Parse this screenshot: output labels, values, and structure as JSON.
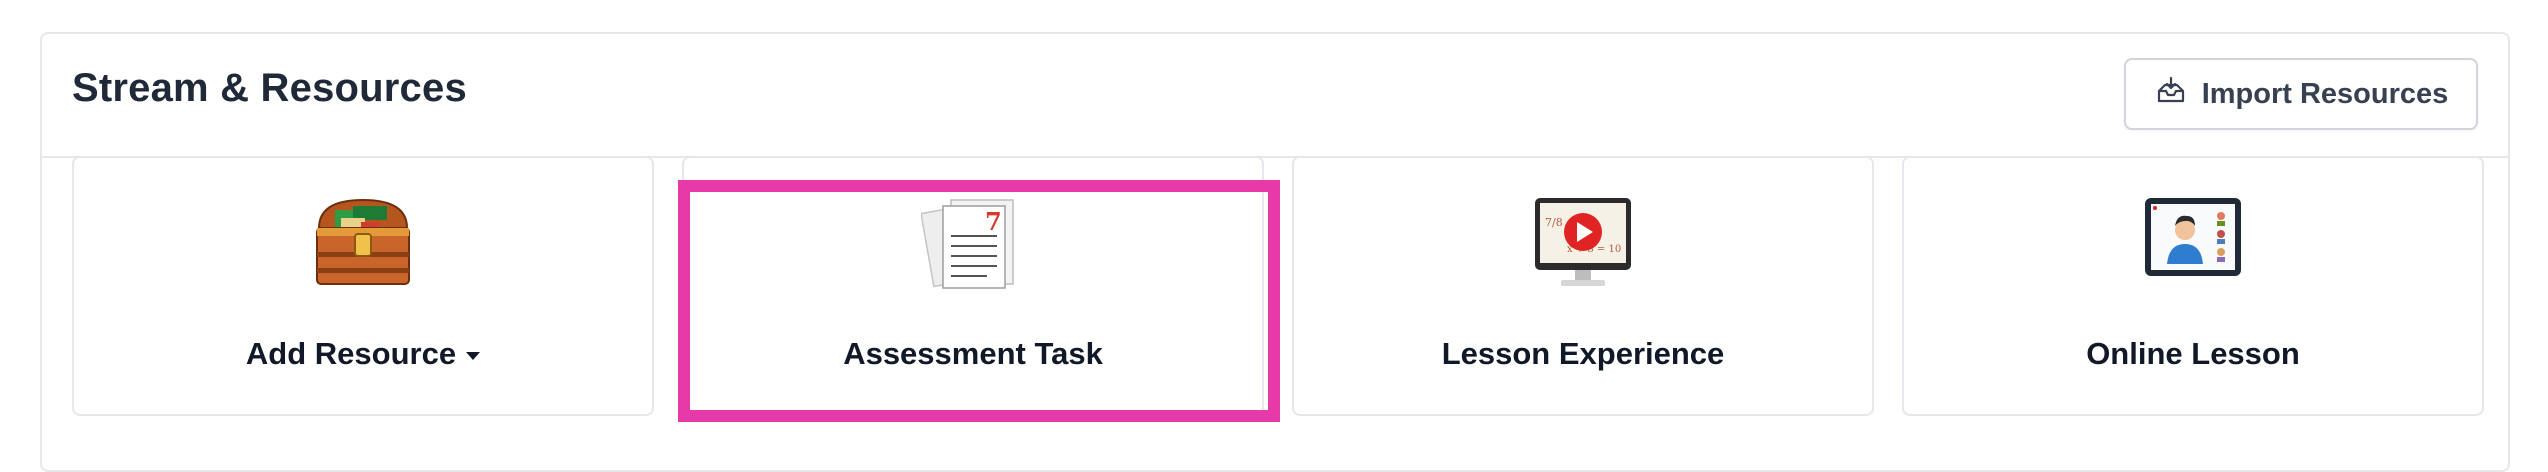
{
  "panel": {
    "title": "Stream & Resources",
    "import_button": {
      "label": "Import Resources",
      "icon": "import-tray-icon"
    }
  },
  "cards": [
    {
      "label": "Add Resource",
      "icon": "treasure-chest-icon",
      "has_dropdown": true
    },
    {
      "label": "Assessment Task",
      "icon": "documents-icon",
      "highlighted": true
    },
    {
      "label": "Lesson Experience",
      "icon": "monitor-play-icon"
    },
    {
      "label": "Online Lesson",
      "icon": "video-call-icon"
    }
  ],
  "colors": {
    "highlight": "#e63aa8",
    "border": "#e5e7eb",
    "text": "#111827",
    "play_red": "#e02424"
  }
}
